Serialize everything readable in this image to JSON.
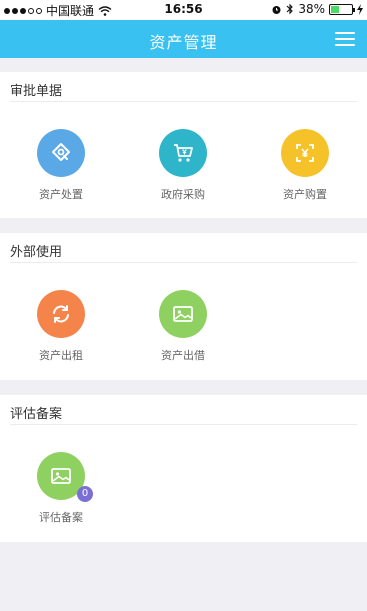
{
  "status_bar": {
    "carrier": "中国联通",
    "time": "16:56",
    "battery": "38%",
    "battery_level": 0.38,
    "icons": [
      "signal-icon",
      "wifi-icon",
      "alarm-icon",
      "bluetooth-icon",
      "battery-icon",
      "charging-icon"
    ]
  },
  "header": {
    "title": "资产管理",
    "menu_icon": "hamburger-menu-icon",
    "background_color": "#39c1f1"
  },
  "sections": [
    {
      "title": "审批单据",
      "items": [
        {
          "label": "资产处置",
          "icon": "disposal-icon",
          "color": "#5ba8e6"
        },
        {
          "label": "政府采购",
          "icon": "shopping-cart-icon",
          "color": "#2fb5c9"
        },
        {
          "label": "资产购置",
          "icon": "yuan-scan-icon",
          "color": "#f6c22a"
        }
      ]
    },
    {
      "title": "外部使用",
      "items": [
        {
          "label": "资产出租",
          "icon": "refresh-icon",
          "color": "#f5844a"
        },
        {
          "label": "资产出借",
          "icon": "image-icon",
          "color": "#8fd161"
        }
      ]
    },
    {
      "title": "评估备案",
      "items": [
        {
          "label": "评估备案",
          "icon": "image-icon",
          "color": "#8fd161",
          "badge": "0"
        }
      ]
    }
  ]
}
